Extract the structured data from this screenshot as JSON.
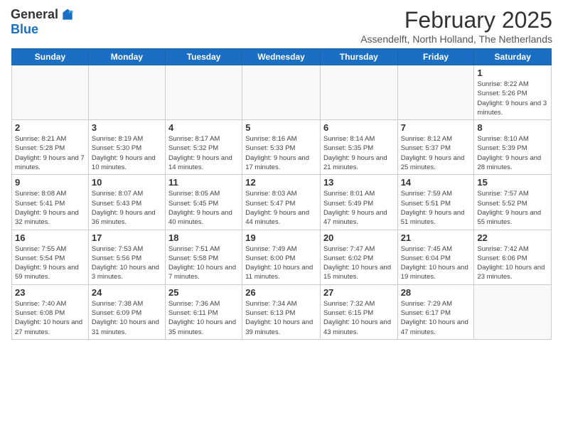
{
  "logo": {
    "general": "General",
    "blue": "Blue"
  },
  "title": "February 2025",
  "location": "Assendelft, North Holland, The Netherlands",
  "days_of_week": [
    "Sunday",
    "Monday",
    "Tuesday",
    "Wednesday",
    "Thursday",
    "Friday",
    "Saturday"
  ],
  "weeks": [
    [
      {
        "day": "",
        "info": ""
      },
      {
        "day": "",
        "info": ""
      },
      {
        "day": "",
        "info": ""
      },
      {
        "day": "",
        "info": ""
      },
      {
        "day": "",
        "info": ""
      },
      {
        "day": "",
        "info": ""
      },
      {
        "day": "1",
        "info": "Sunrise: 8:22 AM\nSunset: 5:26 PM\nDaylight: 9 hours and 3 minutes."
      }
    ],
    [
      {
        "day": "2",
        "info": "Sunrise: 8:21 AM\nSunset: 5:28 PM\nDaylight: 9 hours and 7 minutes."
      },
      {
        "day": "3",
        "info": "Sunrise: 8:19 AM\nSunset: 5:30 PM\nDaylight: 9 hours and 10 minutes."
      },
      {
        "day": "4",
        "info": "Sunrise: 8:17 AM\nSunset: 5:32 PM\nDaylight: 9 hours and 14 minutes."
      },
      {
        "day": "5",
        "info": "Sunrise: 8:16 AM\nSunset: 5:33 PM\nDaylight: 9 hours and 17 minutes."
      },
      {
        "day": "6",
        "info": "Sunrise: 8:14 AM\nSunset: 5:35 PM\nDaylight: 9 hours and 21 minutes."
      },
      {
        "day": "7",
        "info": "Sunrise: 8:12 AM\nSunset: 5:37 PM\nDaylight: 9 hours and 25 minutes."
      },
      {
        "day": "8",
        "info": "Sunrise: 8:10 AM\nSunset: 5:39 PM\nDaylight: 9 hours and 28 minutes."
      }
    ],
    [
      {
        "day": "9",
        "info": "Sunrise: 8:08 AM\nSunset: 5:41 PM\nDaylight: 9 hours and 32 minutes."
      },
      {
        "day": "10",
        "info": "Sunrise: 8:07 AM\nSunset: 5:43 PM\nDaylight: 9 hours and 36 minutes."
      },
      {
        "day": "11",
        "info": "Sunrise: 8:05 AM\nSunset: 5:45 PM\nDaylight: 9 hours and 40 minutes."
      },
      {
        "day": "12",
        "info": "Sunrise: 8:03 AM\nSunset: 5:47 PM\nDaylight: 9 hours and 44 minutes."
      },
      {
        "day": "13",
        "info": "Sunrise: 8:01 AM\nSunset: 5:49 PM\nDaylight: 9 hours and 47 minutes."
      },
      {
        "day": "14",
        "info": "Sunrise: 7:59 AM\nSunset: 5:51 PM\nDaylight: 9 hours and 51 minutes."
      },
      {
        "day": "15",
        "info": "Sunrise: 7:57 AM\nSunset: 5:52 PM\nDaylight: 9 hours and 55 minutes."
      }
    ],
    [
      {
        "day": "16",
        "info": "Sunrise: 7:55 AM\nSunset: 5:54 PM\nDaylight: 9 hours and 59 minutes."
      },
      {
        "day": "17",
        "info": "Sunrise: 7:53 AM\nSunset: 5:56 PM\nDaylight: 10 hours and 3 minutes."
      },
      {
        "day": "18",
        "info": "Sunrise: 7:51 AM\nSunset: 5:58 PM\nDaylight: 10 hours and 7 minutes."
      },
      {
        "day": "19",
        "info": "Sunrise: 7:49 AM\nSunset: 6:00 PM\nDaylight: 10 hours and 11 minutes."
      },
      {
        "day": "20",
        "info": "Sunrise: 7:47 AM\nSunset: 6:02 PM\nDaylight: 10 hours and 15 minutes."
      },
      {
        "day": "21",
        "info": "Sunrise: 7:45 AM\nSunset: 6:04 PM\nDaylight: 10 hours and 19 minutes."
      },
      {
        "day": "22",
        "info": "Sunrise: 7:42 AM\nSunset: 6:06 PM\nDaylight: 10 hours and 23 minutes."
      }
    ],
    [
      {
        "day": "23",
        "info": "Sunrise: 7:40 AM\nSunset: 6:08 PM\nDaylight: 10 hours and 27 minutes."
      },
      {
        "day": "24",
        "info": "Sunrise: 7:38 AM\nSunset: 6:09 PM\nDaylight: 10 hours and 31 minutes."
      },
      {
        "day": "25",
        "info": "Sunrise: 7:36 AM\nSunset: 6:11 PM\nDaylight: 10 hours and 35 minutes."
      },
      {
        "day": "26",
        "info": "Sunrise: 7:34 AM\nSunset: 6:13 PM\nDaylight: 10 hours and 39 minutes."
      },
      {
        "day": "27",
        "info": "Sunrise: 7:32 AM\nSunset: 6:15 PM\nDaylight: 10 hours and 43 minutes."
      },
      {
        "day": "28",
        "info": "Sunrise: 7:29 AM\nSunset: 6:17 PM\nDaylight: 10 hours and 47 minutes."
      },
      {
        "day": "",
        "info": ""
      }
    ]
  ]
}
